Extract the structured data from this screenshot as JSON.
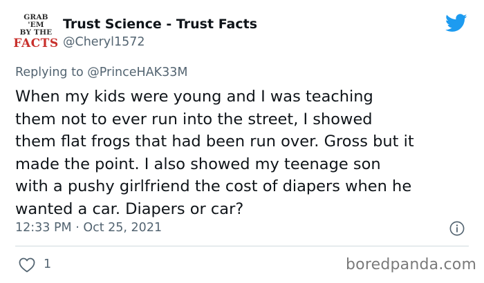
{
  "account": {
    "avatar_lines": [
      "GRAB 'EM",
      "BY THE",
      "FACTS"
    ],
    "display_name": "Trust Science - Trust Facts",
    "handle": "@Cheryl1572"
  },
  "reply": {
    "prefix": "Replying to",
    "mention": "@PrinceHAK33M"
  },
  "tweet": {
    "lines": [
      "When my kids were young and I was teaching",
      "them not to ever run into the street, I showed",
      "them flat frogs that had been run over. Gross but it",
      "made the point. I also showed my teenage son",
      "with a pushy girlfriend the cost of diapers when he",
      "wanted a car. Diapers or car?"
    ],
    "timestamp": "12:33 PM · Oct 25, 2021",
    "likes": "1"
  },
  "icons": {
    "brand": "twitter-bird-icon",
    "info": "info-icon",
    "like": "heart-icon"
  },
  "colors": {
    "twitter_blue": "#1d9bf0",
    "secondary_text": "#536471",
    "primary_text": "#0f1419",
    "avatar_red": "#c8302c"
  },
  "watermark": "boredpanda.com"
}
